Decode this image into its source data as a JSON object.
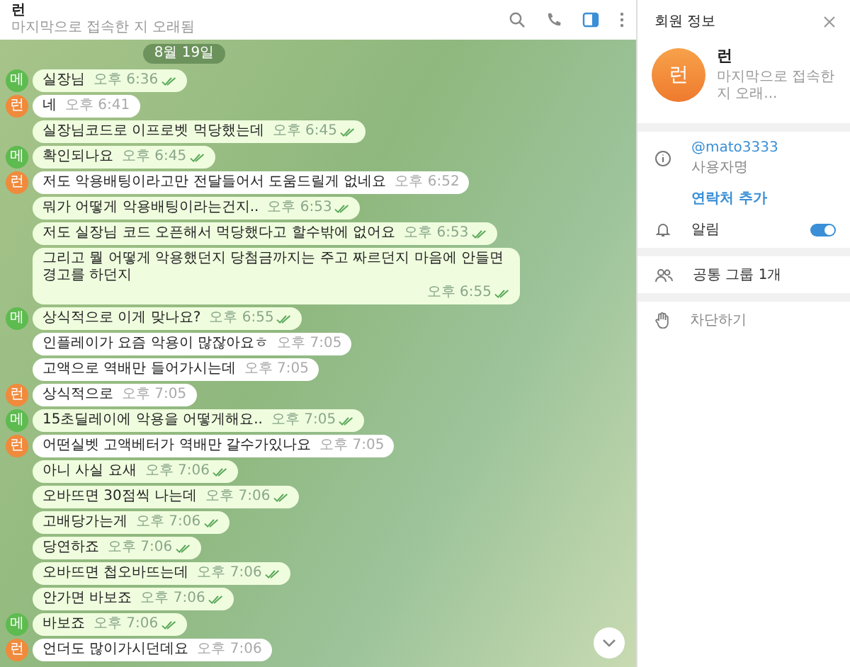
{
  "chat_header": {
    "title": "런",
    "status": "마지막으로 접속한 지 오래됨",
    "info_panel_open": true
  },
  "date_badge": "8월 19일",
  "messages": [
    {
      "kind": "outgoing",
      "text": "실장님",
      "time": "오후 6:36",
      "avatar": {
        "initial": "메",
        "color": "#5dbb4f"
      }
    },
    {
      "kind": "incoming",
      "text": "네",
      "time": "오후 6:41",
      "avatar": {
        "initial": "런",
        "color": "#f08a3c"
      }
    },
    {
      "kind": "outgoing",
      "text": "실장님코드로 이프로벳 먹당했는데",
      "time": "오후 6:45"
    },
    {
      "kind": "outgoing",
      "text": "확인되나요",
      "time": "오후 6:45",
      "avatar": {
        "initial": "메",
        "color": "#5dbb4f"
      }
    },
    {
      "kind": "incoming",
      "text": "저도 악용배팅이라고만 전달들어서 도움드릴게 없네요",
      "time": "오후 6:52",
      "avatar": {
        "initial": "런",
        "color": "#f08a3c"
      }
    },
    {
      "kind": "outgoing",
      "text": "뭐가 어떻게 악용배팅이라는건지..",
      "time": "오후 6:53"
    },
    {
      "kind": "outgoing",
      "text": "저도 실장님 코드 오픈해서 먹당했다고 할수밖에 없어요",
      "time": "오후 6:53"
    },
    {
      "kind": "outgoing",
      "text": "그리고 뭘 어떻게 악용했던지 당첨금까지는 주고 짜르던지 마음에 안들면 경고를 하던지",
      "time": "오후 6:55"
    },
    {
      "kind": "outgoing",
      "text": "상식적으로 이게 맞나요?",
      "time": "오후 6:55",
      "avatar": {
        "initial": "메",
        "color": "#5dbb4f"
      }
    },
    {
      "kind": "incoming",
      "text": "인플레이가 요즘 악용이 많잖아요ㅎ",
      "time": "오후 7:05"
    },
    {
      "kind": "incoming",
      "text": "고액으로 역배만 들어가시는데",
      "time": "오후 7:05"
    },
    {
      "kind": "incoming",
      "text": "상식적으로",
      "time": "오후 7:05",
      "avatar": {
        "initial": "런",
        "color": "#f08a3c"
      }
    },
    {
      "kind": "outgoing",
      "text": "15초딜레이에 악용을 어떻게해요..",
      "time": "오후 7:05",
      "avatar": {
        "initial": "메",
        "color": "#5dbb4f"
      }
    },
    {
      "kind": "incoming",
      "text": "어떤실벳 고액베터가 역배만 갈수가있나요",
      "time": "오후 7:05",
      "avatar": {
        "initial": "런",
        "color": "#f08a3c"
      }
    },
    {
      "kind": "outgoing",
      "text": "아니 사실 요새",
      "time": "오후 7:06"
    },
    {
      "kind": "outgoing",
      "text": "오바뜨면 30점씩 나는데",
      "time": "오후 7:06"
    },
    {
      "kind": "outgoing",
      "text": "고배당가는게",
      "time": "오후 7:06"
    },
    {
      "kind": "outgoing",
      "text": "당연하죠",
      "time": "오후 7:06"
    },
    {
      "kind": "outgoing",
      "text": "오바뜨면 첩오바뜨는데",
      "time": "오후 7:06"
    },
    {
      "kind": "outgoing",
      "text": "안가면 바보죠",
      "time": "오후 7:06"
    },
    {
      "kind": "outgoing",
      "text": "바보죠",
      "time": "오후 7:06",
      "avatar": {
        "initial": "메",
        "color": "#5dbb4f"
      }
    },
    {
      "kind": "incoming",
      "text": "언더도 많이가시던데요",
      "time": "오후 7:06",
      "avatar": {
        "initial": "런",
        "color": "#f08a3c"
      }
    }
  ],
  "info_panel": {
    "title": "회원 정보",
    "avatar_initial": "런",
    "name": "런",
    "status": "마지막으로 접속한 지 오래...",
    "username": "@mato3333",
    "username_label": "사용자명",
    "add_contact": "연락처 추가",
    "notifications": {
      "label": "알림",
      "on": true
    },
    "common_groups": "공통 그룹 1개",
    "block": "차단하기"
  }
}
